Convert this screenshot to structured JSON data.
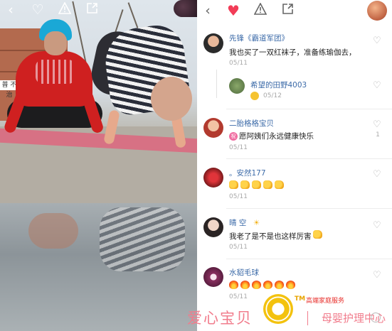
{
  "left_panel": {
    "sign_text": "普 不治"
  },
  "toolbar": {
    "back_icon": "chevron-left-icon",
    "like_icon": "heart-icon",
    "report_icon": "warning-icon",
    "share_icon": "share-icon"
  },
  "comments": [
    {
      "name": "先锋《霸道军团》",
      "text": "我也买了一双红袜子，准备练瑜伽去，",
      "date": "05/11",
      "likes": ""
    },
    {
      "name": "希望的田野4003",
      "text": "",
      "date": "05/12",
      "likes": "",
      "is_reply": true
    },
    {
      "name": "二胎格格宝贝",
      "text": "愿阿姨们永远健康快乐",
      "tag": "祝",
      "date": "05/11",
      "likes": "1"
    },
    {
      "name": "。安然177",
      "text": "",
      "emoji": [
        "thumbs-up",
        "thumbs-up",
        "thumbs-up",
        "thumbs-up",
        "thumbs-up"
      ],
      "date": "05/11",
      "likes": ""
    },
    {
      "name": "晴 空",
      "text": "我老了是不是也这样厉害",
      "date": "05/11",
      "likes": ""
    },
    {
      "name": "水貂毛球",
      "text": "",
      "emoji": [
        "fire",
        "fire",
        "fire",
        "fire",
        "fire",
        "fire"
      ],
      "date": "05/11",
      "likes": ""
    }
  ],
  "watermark": {
    "brand_left": "爱心宝贝",
    "tm": "TM",
    "slogan": "高端家庭服务",
    "brand_right": "母婴护理中心"
  }
}
